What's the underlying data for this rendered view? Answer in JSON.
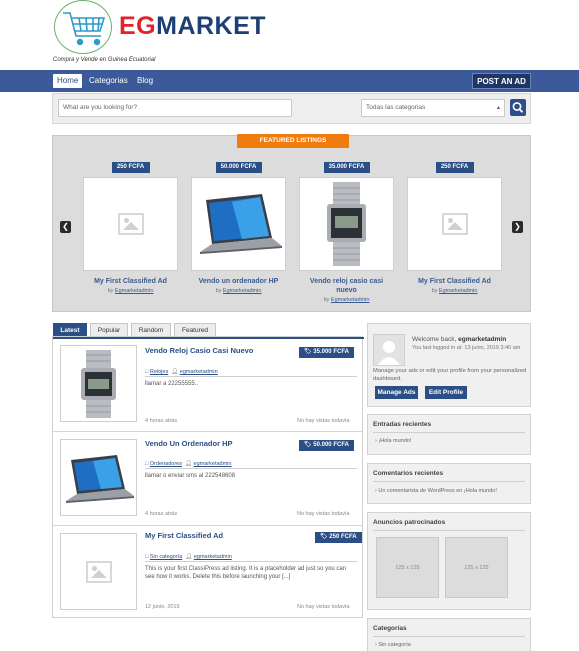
{
  "header": {
    "logo_eg": "EG",
    "logo_market": "MARKET",
    "tagline": "Compra y Vende en Guinea Ecuatorial"
  },
  "nav": {
    "items": [
      "Home",
      "Categorias",
      "Blog"
    ],
    "post_ad": "POST AN AD"
  },
  "search": {
    "placeholder": "What are you looking for?",
    "category_selected": "Todas las categorias"
  },
  "featured": {
    "label": "FEATURED LISTINGS",
    "by_prefix": "by",
    "items": [
      {
        "price": "250 FCFA",
        "title": "My First Classified Ad",
        "author": "Egmarketadmin",
        "image": "placeholder"
      },
      {
        "price": "50.000 FCFA",
        "title": "Vendo un ordenador HP",
        "author": "Egmarketadmin",
        "image": "laptop"
      },
      {
        "price": "35.000 FCFA",
        "title": "Vendo reloj casio casi nuevo",
        "author": "Egmarketadmin",
        "image": "watch"
      },
      {
        "price": "250 FCFA",
        "title": "My First Classified Ad",
        "author": "Egmarketadmin",
        "image": "placeholder"
      }
    ]
  },
  "tabs": [
    "Latest",
    "Popular",
    "Random",
    "Featured"
  ],
  "listings": [
    {
      "title": "Vendo Reloj Casio Casi Nuevo",
      "price": "35.000 FCFA",
      "category": "Relojes",
      "author": "egmarketadmin",
      "desc": "llamar a 22255555..",
      "time": "4 horas atrás",
      "views": "No hay vistas todavía",
      "image": "watch"
    },
    {
      "title": "Vendo Un Ordenador HP",
      "price": "50.000 FCFA",
      "category": "Ordenadores",
      "author": "egmarketadmin",
      "desc": "llamar o enviar sms al 222548608",
      "time": "4 horas atrás",
      "views": "No hay vistas todavía",
      "image": "laptop"
    },
    {
      "title": "My First Classified Ad",
      "price": "250 FCFA",
      "category": "Sin categoría",
      "author": "egmarketadmin",
      "desc": "This is your first ClassiPress ad listing. It is a placeholder ad just so you can see how it works. Delete this before launching your [...]",
      "time": "12 junio, 2019",
      "views": "No hay vistas todavía",
      "image": "placeholder"
    }
  ],
  "sidebar": {
    "welcome_prefix": "Welcome back,",
    "username": "egmarketadmin",
    "last_login": "You last logged in at: 13 junio, 2019 3:40 am",
    "manage_text": "Manage your ads or edit your profile from your personalized dashboard.",
    "manage_btn": "Manage Ads",
    "edit_btn": "Edit Profile",
    "recent_entries_title": "Entradas recientes",
    "recent_entries": [
      "¡Hola mundo!"
    ],
    "recent_comments_title": "Comentarios recientes",
    "recent_comments": [
      "Un comentarista de WordPress en ¡Hola mundo!"
    ],
    "sponsored_title": "Anuncios patrocinados",
    "ad_sizes": [
      "125 x 125",
      "125 x 125"
    ],
    "categories_title": "Categorías",
    "categories": [
      "Sin categoría"
    ]
  },
  "colors": {
    "nav_blue": "#3c5a9a",
    "dark_blue": "#2b4e84",
    "orange": "#f07c10",
    "logo_red": "#e0242b"
  }
}
